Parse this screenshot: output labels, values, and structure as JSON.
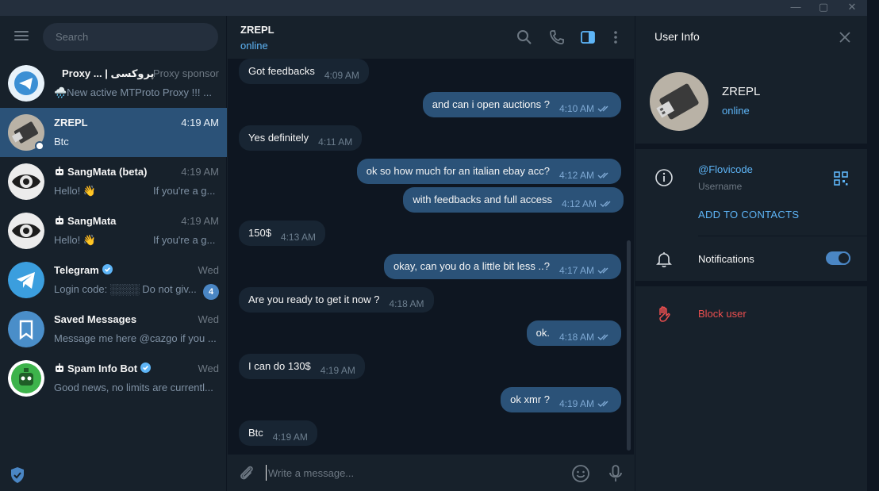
{
  "colors": {
    "accent": "#5eb5f7",
    "active_chat": "#2b5278",
    "danger": "#ec4f4f",
    "badge": "#4a86c4"
  },
  "window_controls": [
    "minimize-icon",
    "maximize-icon",
    "close-icon"
  ],
  "sidebar": {
    "search_placeholder": "Search",
    "chats": [
      {
        "name": "Proxy ... | پروکسی",
        "time": "Proxy sponsor",
        "message": "🌧️New active MTProto Proxy !!! ...",
        "avatar_icon": "telegram-proxy-logo"
      },
      {
        "name": "ZREPL",
        "time": "4:19 AM",
        "message": "Btc",
        "avatar_icon": "usb-stick-avatar",
        "active": true
      },
      {
        "name": "SangMata (beta)",
        "time": "4:19 AM",
        "message": "Hello! 👋",
        "message2": "If you're a g...",
        "avatar_icon": "eye-avatar",
        "bot": true
      },
      {
        "name": "SangMata",
        "time": "4:19 AM",
        "message": "Hello! 👋",
        "message2": "If you're a g...",
        "avatar_icon": "eye-avatar",
        "bot": true
      },
      {
        "name": "Telegram",
        "time": "Wed",
        "message": "Login code: ░░░░ Do not giv...",
        "avatar_icon": "telegram-logo",
        "verified": true,
        "badge": "4"
      },
      {
        "name": "Saved Messages",
        "time": "Wed",
        "message": "Message me here @cazgo if you ...",
        "avatar_icon": "bookmark-icon"
      },
      {
        "name": "Spam Info Bot",
        "time": "Wed",
        "message": "Good news, no limits are currentl...",
        "avatar_icon": "robot-avatar",
        "bot": true,
        "verified": true
      }
    ]
  },
  "chat": {
    "title": "ZREPL",
    "status": "online",
    "composer_placeholder": "Write a message...",
    "messages": [
      {
        "dir": "in",
        "text": "Got feedbacks",
        "time": "4:09 AM"
      },
      {
        "dir": "out",
        "text": "and can i open auctions ?",
        "time": "4:10 AM"
      },
      {
        "dir": "in",
        "text": "Yes definitely",
        "time": "4:11 AM"
      },
      {
        "dir": "out",
        "text": "ok so how much for an italian ebay acc?",
        "time": "4:12 AM"
      },
      {
        "dir": "out",
        "text": "with feedbacks and full access",
        "time": "4:12 AM"
      },
      {
        "dir": "in",
        "text": "150$",
        "time": "4:13 AM"
      },
      {
        "dir": "out",
        "text": "okay, can you do a little bit less ..?",
        "time": "4:17 AM"
      },
      {
        "dir": "in",
        "text": "Are you ready to get it now ?",
        "time": "4:18 AM"
      },
      {
        "dir": "out",
        "text": "ok.",
        "time": "4:18 AM"
      },
      {
        "dir": "in",
        "text": "I can do 130$",
        "time": "4:19 AM"
      },
      {
        "dir": "out",
        "text": "ok xmr ?",
        "time": "4:19 AM"
      },
      {
        "dir": "in",
        "text": "Btc",
        "time": "4:19 AM"
      }
    ]
  },
  "info": {
    "title": "User Info",
    "name": "ZREPL",
    "status": "online",
    "username": "@Flovicode",
    "username_label": "Username",
    "add_contacts": "ADD TO CONTACTS",
    "notifications": "Notifications",
    "notifications_on": true,
    "block": "Block user"
  }
}
